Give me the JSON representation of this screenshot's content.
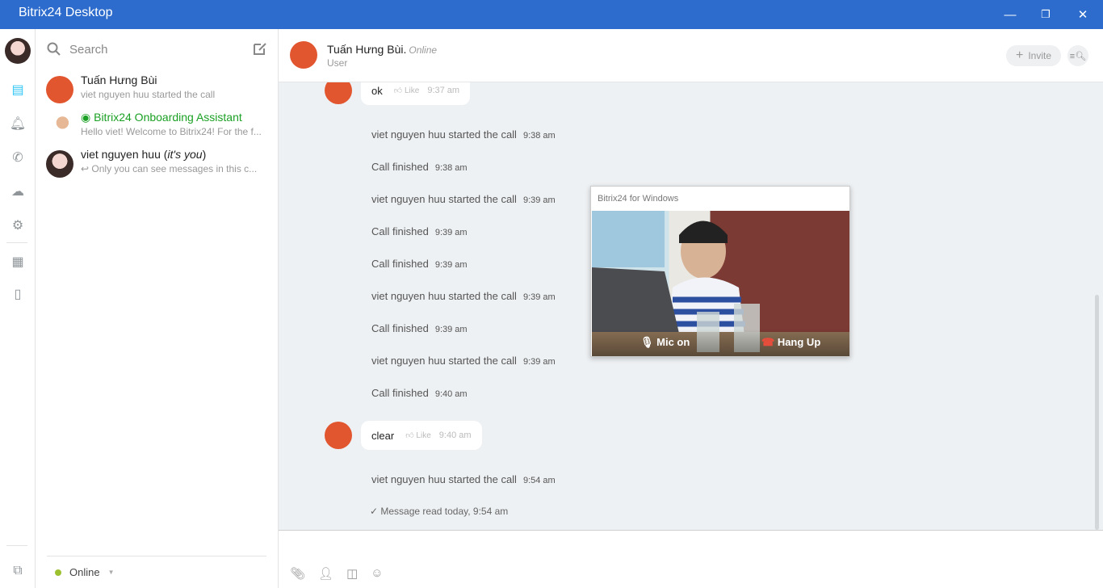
{
  "window": {
    "title": "Bitrix24 Desktop",
    "minimize": "—",
    "restore": "❐",
    "close": "✕"
  },
  "sidebar": {
    "search_placeholder": "Search",
    "recent": [
      {
        "name": "Tuấn Hưng Bùi",
        "last": "viet nguyen huu started the call"
      },
      {
        "name": "Bitrix24 Onboarding Assistant",
        "last": "Hello viet! Welcome to Bitrix24! For the f..."
      },
      {
        "name": "viet nguyen huu",
        "name_suffix": "it's you",
        "last": "Only you can see messages in this c..."
      }
    ],
    "status": "Online"
  },
  "header": {
    "name": "Tuấn Hưng Bùi.",
    "presence": "Online",
    "role": "User",
    "invite": "Invite"
  },
  "messages": [
    {
      "text": "ok",
      "like": "Like",
      "time": "9:37 am"
    },
    {
      "text": "viet nguyen huu started the call",
      "time": "9:38 am"
    },
    {
      "text": "Call finished",
      "time": "9:38 am"
    },
    {
      "text": "viet nguyen huu started the call",
      "time": "9:39 am"
    },
    {
      "text": "Call finished",
      "time": "9:39 am"
    },
    {
      "text": "Call finished",
      "time": "9:39 am"
    },
    {
      "text": "viet nguyen huu started the call",
      "time": "9:39 am"
    },
    {
      "text": "Call finished",
      "time": "9:39 am"
    },
    {
      "text": "viet nguyen huu started the call",
      "time": "9:39 am"
    },
    {
      "text": "Call finished",
      "time": "9:40 am"
    },
    {
      "text": "clear",
      "like": "Like",
      "time": "9:40 am"
    },
    {
      "text": "viet nguyen huu started the call",
      "time": "9:54 am"
    }
  ],
  "read_receipt": "Message read today, 9:54 am",
  "call_window": {
    "title": "Bitrix24 for Windows",
    "mic": "Mic on",
    "hangup": "Hang Up"
  },
  "colors": {
    "titlebar": "#2d6ccd",
    "accent": "#e2562f",
    "online": "#9dc12e",
    "assistant": "#1aa023"
  }
}
